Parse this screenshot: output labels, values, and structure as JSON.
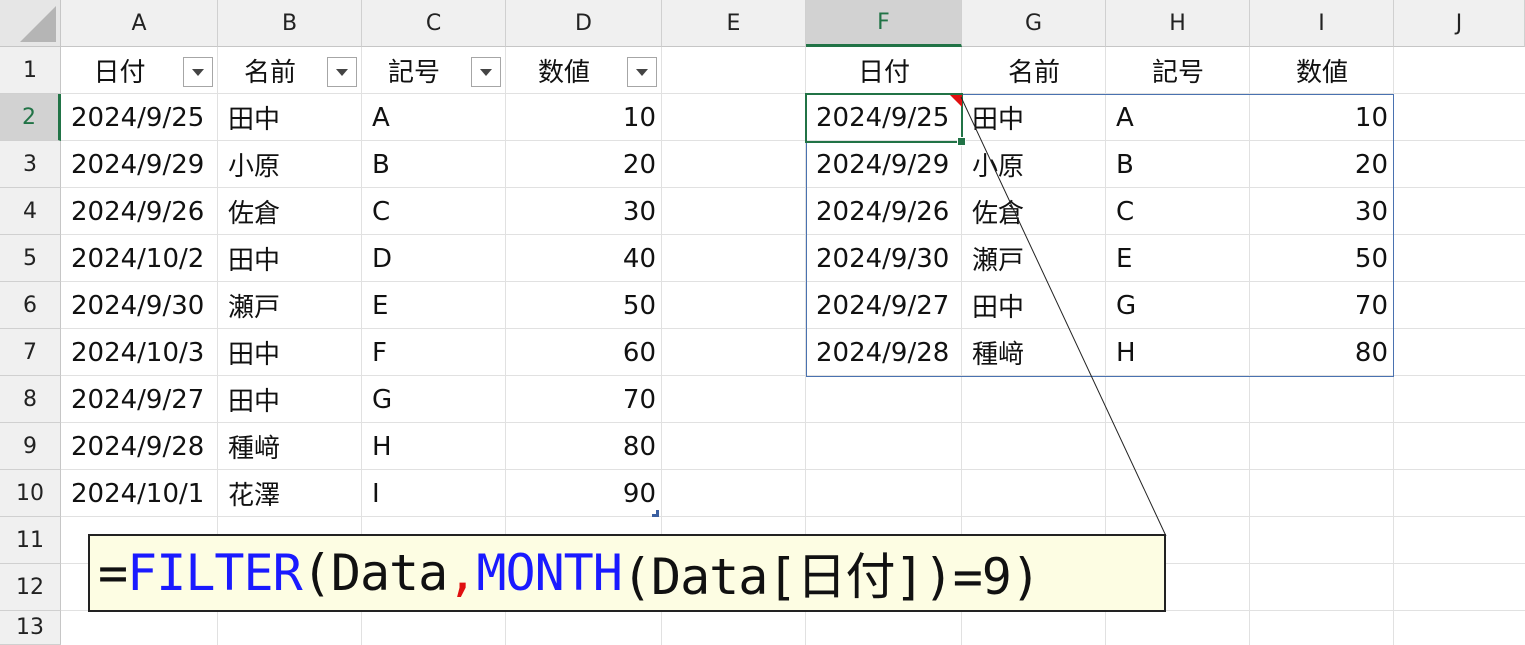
{
  "columns": [
    "A",
    "B",
    "C",
    "D",
    "E",
    "F",
    "G",
    "H",
    "I",
    "J"
  ],
  "rows": [
    "1",
    "2",
    "3",
    "4",
    "5",
    "6",
    "7",
    "8",
    "9",
    "10",
    "11",
    "12",
    "13"
  ],
  "table": {
    "headers": [
      "日付",
      "名前",
      "記号",
      "数値"
    ],
    "rows": [
      [
        "2024/9/25",
        "田中",
        "A",
        "10"
      ],
      [
        "2024/9/29",
        "小原",
        "B",
        "20"
      ],
      [
        "2024/9/26",
        "佐倉",
        "C",
        "30"
      ],
      [
        "2024/10/2",
        "田中",
        "D",
        "40"
      ],
      [
        "2024/9/30",
        "瀬戸",
        "E",
        "50"
      ],
      [
        "2024/10/3",
        "田中",
        "F",
        "60"
      ],
      [
        "2024/9/27",
        "田中",
        "G",
        "70"
      ],
      [
        "2024/9/28",
        "種﨑",
        "H",
        "80"
      ],
      [
        "2024/10/1",
        "花澤",
        "I",
        "90"
      ]
    ]
  },
  "result": {
    "headers": [
      "日付",
      "名前",
      "記号",
      "数値"
    ],
    "rows": [
      [
        "2024/9/25",
        "田中",
        "A",
        "10"
      ],
      [
        "2024/9/29",
        "小原",
        "B",
        "20"
      ],
      [
        "2024/9/26",
        "佐倉",
        "C",
        "30"
      ],
      [
        "2024/9/30",
        "瀬戸",
        "E",
        "50"
      ],
      [
        "2024/9/27",
        "田中",
        "G",
        "70"
      ],
      [
        "2024/9/28",
        "種﨑",
        "H",
        "80"
      ]
    ]
  },
  "selection": {
    "column": "F",
    "row": "2"
  },
  "formula": {
    "tokens": [
      {
        "text": "=",
        "color": "black"
      },
      {
        "text": "FILTER",
        "color": "blue"
      },
      {
        "text": "(Data",
        "color": "black"
      },
      {
        "text": ",",
        "color": "red"
      },
      {
        "text": "MONTH",
        "color": "blue"
      },
      {
        "text": "(Data[日付])=9)",
        "color": "black"
      }
    ]
  },
  "colors": {
    "selection": "#217346",
    "spill_border": "#4a72b0",
    "formula_bg": "#fdfde3",
    "function_blue": "#1a1aff",
    "separator_red": "#e01010"
  }
}
